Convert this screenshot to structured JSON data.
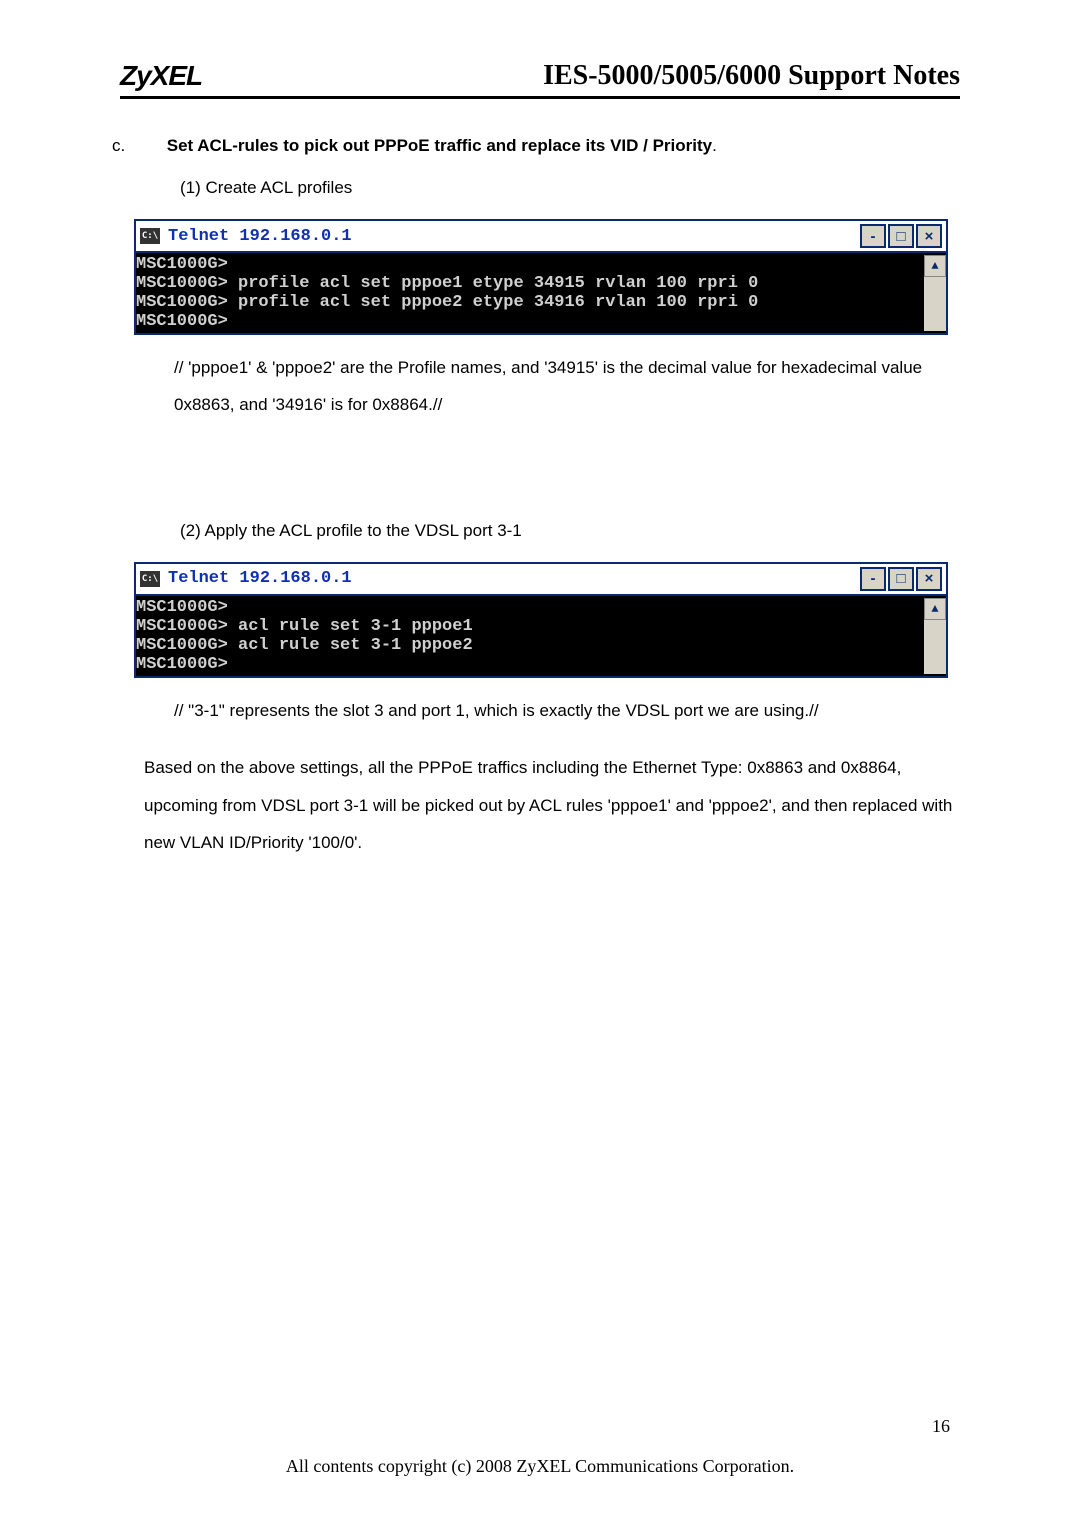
{
  "header": {
    "brand": "ZyXEL",
    "title": "IES-5000/5005/6000 Support Notes"
  },
  "section_c": {
    "label": "c.",
    "heading_bold": "Set ACL-rules to pick out PPPoE traffic and replace its VID / Priority",
    "heading_tail": "."
  },
  "step1": {
    "label": "(1)  Create ACL profiles"
  },
  "telnet1": {
    "title": "Telnet 192.168.0.1",
    "icon_text": "C:\\",
    "btn_min": "-",
    "btn_max": "□",
    "btn_close": "×",
    "scroll_up": "▲",
    "lines": "MSC1000G>\nMSC1000G> profile acl set pppoe1 etype 34915 rvlan 100 rpri 0\nMSC1000G> profile acl set pppoe2 etype 34916 rvlan 100 rpri 0\nMSC1000G>"
  },
  "note1": "// 'pppoe1' & 'pppoe2' are the Profile names, and '34915' is the decimal value for hexadecimal value 0x8863, and '34916' is for 0x8864.//",
  "step2": {
    "label": "(2)  Apply the ACL profile to the VDSL port 3-1"
  },
  "telnet2": {
    "title": "Telnet 192.168.0.1",
    "icon_text": "C:\\",
    "btn_min": "-",
    "btn_max": "□",
    "btn_close": "×",
    "scroll_up": "▲",
    "lines": "MSC1000G>\nMSC1000G> acl rule set 3-1 pppoe1\nMSC1000G> acl rule set 3-1 pppoe2\nMSC1000G>"
  },
  "note2": "// \"3-1\" represents the slot 3 and port 1, which is exactly the VDSL port we are using.//",
  "para1": "Based on the above settings, all the PPPoE traffics including the Ethernet Type: 0x8863 and 0x8864, upcoming from VDSL port 3-1 will be picked out by ACL rules 'pppoe1' and 'pppoe2', and then replaced with new VLAN ID/Priority '100/0'.",
  "page_number": "16",
  "footer": "All contents copyright (c) 2008 ZyXEL Communications Corporation."
}
